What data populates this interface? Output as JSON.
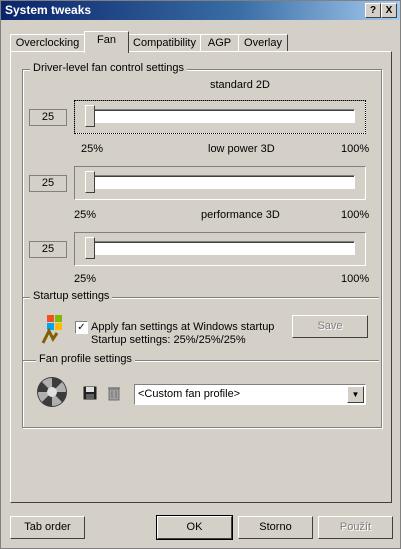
{
  "window": {
    "title": "System tweaks",
    "help_btn": "?",
    "close_btn": "X"
  },
  "tabs": [
    {
      "label": "Overclocking"
    },
    {
      "label": "Fan"
    },
    {
      "label": "Compatibility"
    },
    {
      "label": "AGP"
    },
    {
      "label": "Overlay"
    }
  ],
  "fan_control": {
    "group_title": "Driver-level fan control settings",
    "sliders": [
      {
        "name": "standard 2D",
        "value": "25",
        "min_label": "25%",
        "max_label": "100%",
        "level_percent": 25
      },
      {
        "name": "low power 3D",
        "value": "25",
        "min_label": "25%",
        "max_label": "100%",
        "level_percent": 25
      },
      {
        "name": "performance 3D",
        "value": "25",
        "min_label": "25%",
        "max_label": "100%",
        "level_percent": 25
      }
    ]
  },
  "startup": {
    "title": "Startup settings",
    "checkbox_label": "Apply fan settings at Windows startup",
    "checked": true,
    "status": "Startup settings:  25%/25%/25%",
    "save_label": "Save"
  },
  "fan_profile": {
    "title": "Fan profile settings",
    "selected": "<Custom fan profile>"
  },
  "footer": {
    "tab_order": "Tab order",
    "ok": "OK",
    "cancel": "Storno",
    "apply": "Použít"
  }
}
